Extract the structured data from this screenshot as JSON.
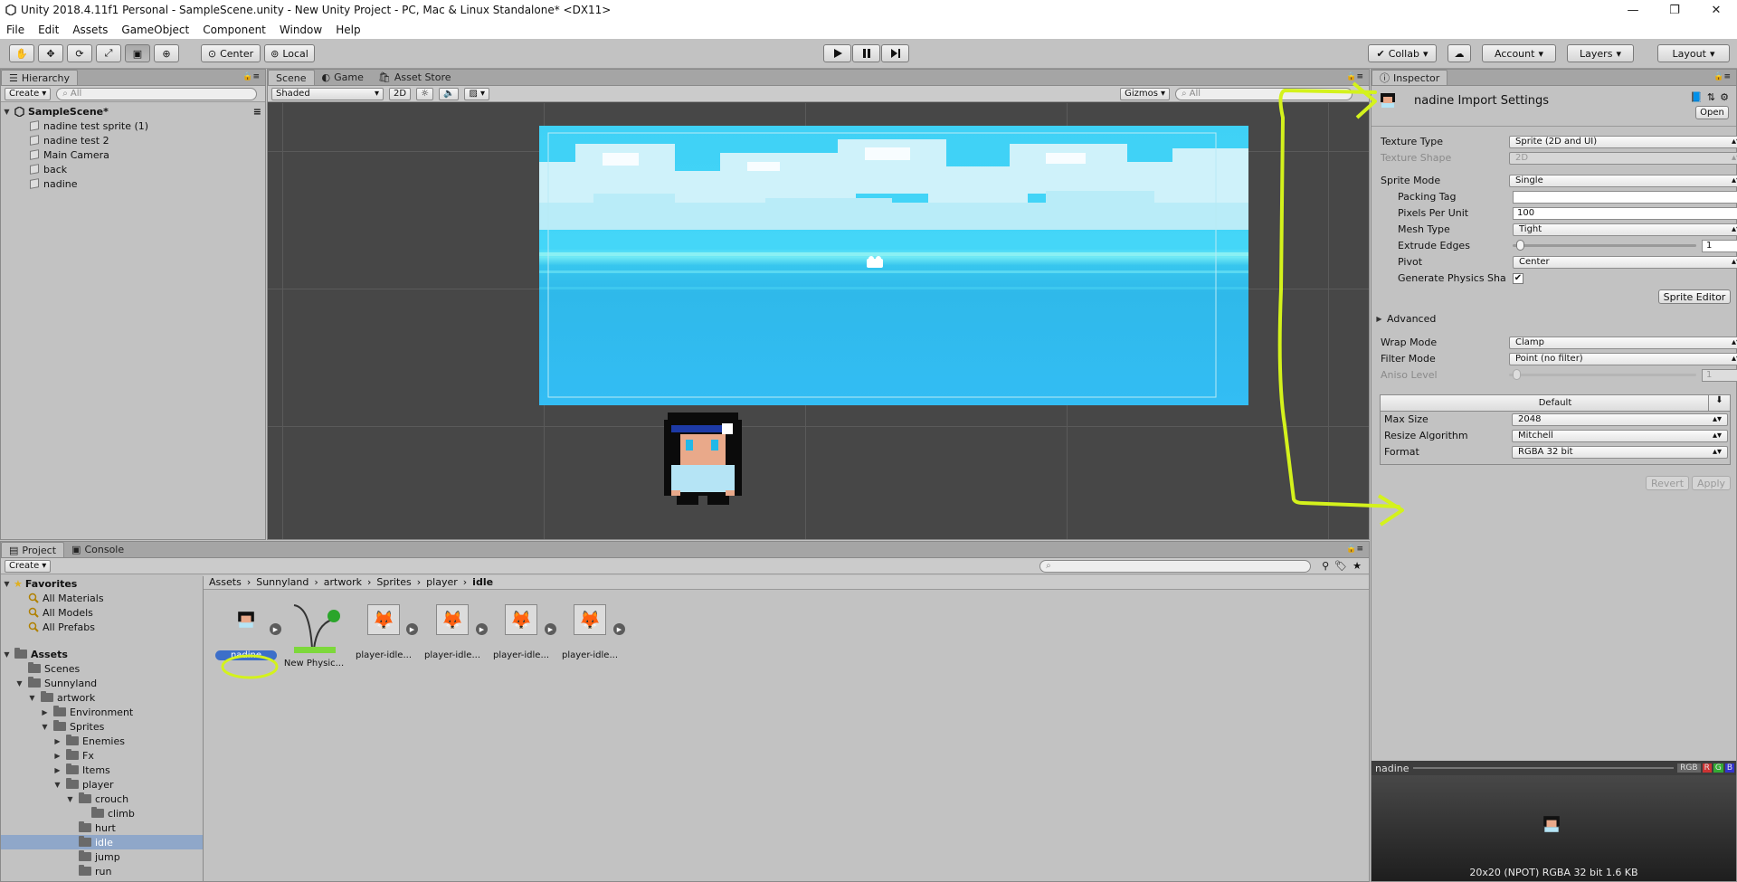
{
  "window": {
    "title": "Unity 2018.4.11f1 Personal - SampleScene.unity - New Unity Project - PC, Mac & Linux Standalone* <DX11>"
  },
  "menu": [
    "File",
    "Edit",
    "Assets",
    "GameObject",
    "Component",
    "Window",
    "Help"
  ],
  "toolbar": {
    "pivot_label": "Center",
    "space_label": "Local",
    "collab_label": "Collab",
    "account_label": "Account",
    "layers_label": "Layers",
    "layout_label": "Layout"
  },
  "hierarchy": {
    "tab_label": "Hierarchy",
    "create_label": "Create",
    "search_placeholder": "All",
    "scene_name": "SampleScene*",
    "items": [
      "nadine test sprite (1)",
      "nadine test 2",
      "Main Camera",
      "back",
      "nadine"
    ]
  },
  "scene_view": {
    "tabs": [
      "Scene",
      "Game",
      "Asset Store"
    ],
    "shading_mode": "Shaded",
    "mode_2d_label": "2D",
    "gizmos_label": "Gizmos",
    "search_placeholder": "All"
  },
  "inspector": {
    "tab_label": "Inspector",
    "asset_title": "nadine Import Settings",
    "open_label": "Open",
    "fields": {
      "texture_type_label": "Texture Type",
      "texture_type_value": "Sprite (2D and UI)",
      "texture_shape_label": "Texture Shape",
      "texture_shape_value": "2D",
      "sprite_mode_label": "Sprite Mode",
      "sprite_mode_value": "Single",
      "packing_tag_label": "Packing Tag",
      "packing_tag_value": "",
      "pixels_per_unit_label": "Pixels Per Unit",
      "pixels_per_unit_value": "100",
      "mesh_type_label": "Mesh Type",
      "mesh_type_value": "Tight",
      "extrude_edges_label": "Extrude Edges",
      "extrude_edges_value": "1",
      "pivot_label": "Pivot",
      "pivot_value": "Center",
      "generate_physics_label": "Generate Physics Sha",
      "generate_physics_checked": true,
      "sprite_editor_label": "Sprite Editor",
      "advanced_label": "Advanced",
      "wrap_mode_label": "Wrap Mode",
      "wrap_mode_value": "Clamp",
      "filter_mode_label": "Filter Mode",
      "filter_mode_value": "Point (no filter)",
      "aniso_level_label": "Aniso Level",
      "aniso_level_value": "1",
      "platform_tab_label": "Default",
      "max_size_label": "Max Size",
      "max_size_value": "2048",
      "resize_algorithm_label": "Resize Algorithm",
      "resize_algorithm_value": "Mitchell",
      "format_label": "Format",
      "format_value": "RGBA 32 bit"
    },
    "revert_label": "Revert",
    "apply_label": "Apply",
    "preview": {
      "name": "nadine",
      "channels": [
        "RGB",
        "R",
        "G",
        "B"
      ],
      "info": "20x20 (NPOT)  RGBA 32 bit   1.6 KB"
    }
  },
  "project": {
    "tabs": [
      "Project",
      "Console"
    ],
    "create_label": "Create",
    "favorites_label": "Favorites",
    "favorites": [
      "All Materials",
      "All Models",
      "All Prefabs"
    ],
    "assets_label": "Assets",
    "tree": [
      {
        "label": "Scenes",
        "depth": 1
      },
      {
        "label": "Sunnyland",
        "depth": 1
      },
      {
        "label": "artwork",
        "depth": 2
      },
      {
        "label": "Environment",
        "depth": 3
      },
      {
        "label": "Sprites",
        "depth": 3
      },
      {
        "label": "Enemies",
        "depth": 4
      },
      {
        "label": "Fx",
        "depth": 4
      },
      {
        "label": "Items",
        "depth": 4
      },
      {
        "label": "player",
        "depth": 4
      },
      {
        "label": "crouch",
        "depth": 5
      },
      {
        "label": "climb",
        "depth": 6
      },
      {
        "label": "hurt",
        "depth": 5
      },
      {
        "label": "idle",
        "depth": 5
      },
      {
        "label": "jump",
        "depth": 5
      },
      {
        "label": "run",
        "depth": 5
      }
    ],
    "breadcrumb": [
      "Assets",
      "Sunnyland",
      "artwork",
      "Sprites",
      "player",
      "idle"
    ],
    "assets": [
      "nadine",
      "New Physic...",
      "player-idle...",
      "player-idle...",
      "player-idle...",
      "player-idle..."
    ]
  },
  "colors": {
    "annotation": "#d4f21c",
    "selection": "#3d6fc9",
    "sky": "#3cd0f5"
  }
}
